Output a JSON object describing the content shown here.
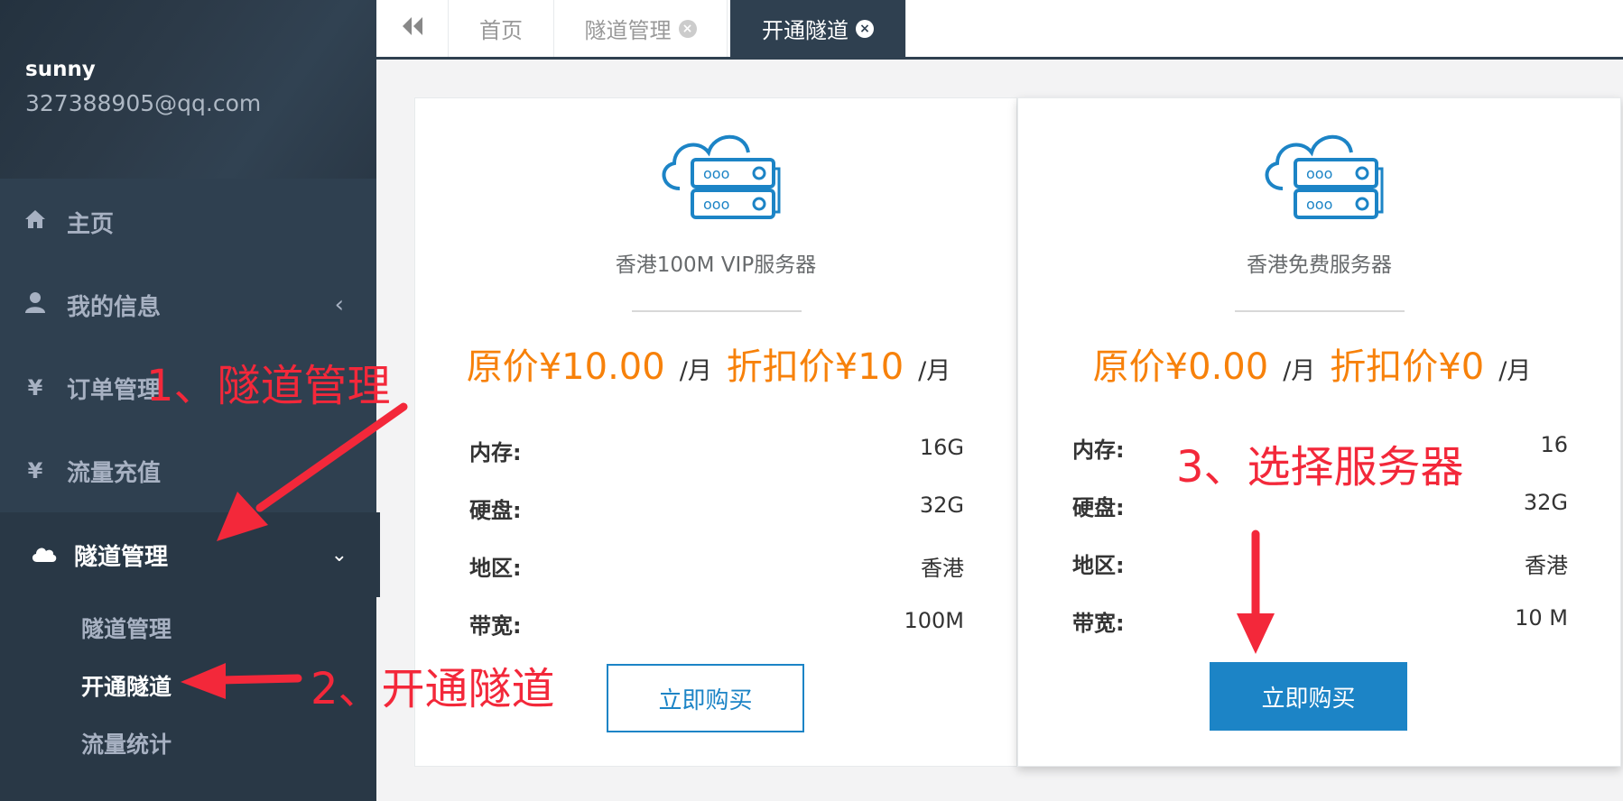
{
  "user": {
    "name": "sunny",
    "email": "327388905@qq.com"
  },
  "nav": {
    "home": {
      "label": "主页",
      "icon": "home-icon"
    },
    "profile": {
      "label": "我的信息",
      "icon": "user-icon"
    },
    "orders": {
      "label": "订单管理",
      "icon": "yen-icon"
    },
    "recharge": {
      "label": "流量充值",
      "icon": "yen-icon"
    },
    "tunnel": {
      "label": "隧道管理",
      "icon": "cloud-icon"
    },
    "sub": [
      "隧道管理",
      "开通隧道",
      "流量统计"
    ]
  },
  "tabs": {
    "home": "首页",
    "tunnel_manage": "隧道管理",
    "open_tunnel": "开通隧道"
  },
  "plans": [
    {
      "name": "香港100M VIP服务器",
      "orig_price": "原价¥10.00",
      "unit": "/月",
      "discount_price": "折扣价¥10",
      "specs": [
        {
          "label": "内存:",
          "value": "16G"
        },
        {
          "label": "硬盘:",
          "value": "32G"
        },
        {
          "label": "地区:",
          "value": "香港"
        },
        {
          "label": "带宽:",
          "value": "100M"
        }
      ],
      "buy_label": "立即购买"
    },
    {
      "name": "香港免费服务器",
      "orig_price": "原价¥0.00",
      "unit": "/月",
      "discount_price": "折扣价¥0",
      "specs": [
        {
          "label": "内存:",
          "value": "16"
        },
        {
          "label": "硬盘:",
          "value": "32G"
        },
        {
          "label": "地区:",
          "value": "香港"
        },
        {
          "label": "带宽:",
          "value": "10 M"
        }
      ],
      "buy_label": "立即购买"
    }
  ],
  "annotations": {
    "step1": "1、隧道管理",
    "step2": "2、开通隧道",
    "step3": "3、选择服务器"
  },
  "colors": {
    "sidebar": "#2f4050",
    "accent": "#1c84c6",
    "price": "#f7810a",
    "annotation": "#f3283a"
  }
}
